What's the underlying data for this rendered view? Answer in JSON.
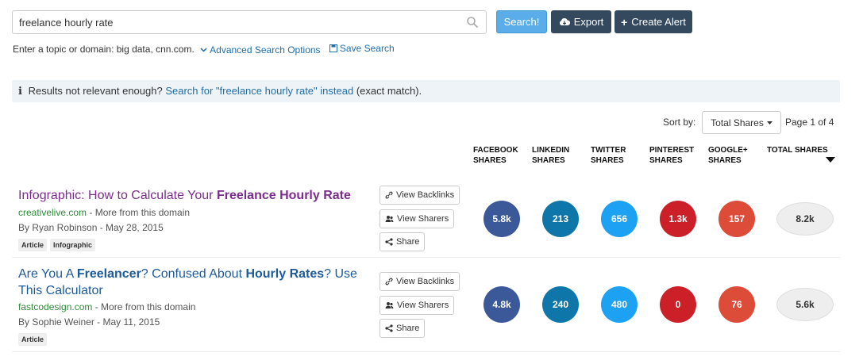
{
  "search": {
    "value": "freelance hourly rate"
  },
  "toolbar": {
    "search_label": "Search!",
    "export_label": "Export",
    "alert_label": "Create Alert"
  },
  "hint": {
    "text": "Enter a topic or domain: big data, cnn.com.",
    "advanced": "Advanced Search Options",
    "save": "Save Search"
  },
  "info": {
    "prefix": "Results not relevant enough?",
    "link": "Search for \"freelance hourly rate\" instead",
    "suffix": "(exact match)."
  },
  "sort": {
    "label": "Sort by:",
    "value": "Total Shares",
    "page": "Page 1 of 4"
  },
  "columns": [
    "FACEBOOK SHARES",
    "LINKEDIN SHARES",
    "TWITTER SHARES",
    "PINTEREST SHARES",
    "GOOGLE+ SHARES",
    "TOTAL SHARES"
  ],
  "colors": {
    "facebook": "#3b5998",
    "linkedin": "#0e76a8",
    "twitter": "#1da1f2",
    "pinterest": "#cb2027",
    "google": "#dd4b39"
  },
  "actions": {
    "backlinks": "View Backlinks",
    "sharers": "View Sharers",
    "share": "Share"
  },
  "results": [
    {
      "title_parts": [
        "Infographic: How to Calculate Your ",
        "Freelance Hourly Rate"
      ],
      "domain": "creativelive.com",
      "more": " - More from this domain",
      "byline": "By Ryan Robinson - May 28, 2015",
      "tags": [
        "Article",
        "Infographic"
      ],
      "facebook": "5.8k",
      "linkedin": "213",
      "twitter": "656",
      "pinterest": "1.3k",
      "google": "157",
      "total": "8.2k"
    },
    {
      "title_parts": [
        "Are You A ",
        "Freelancer",
        "? Confused About ",
        "Hourly Rates",
        "? Use This Calculator"
      ],
      "domain": "fastcodesign.com",
      "more": " - More from this domain",
      "byline": "By Sophie Weiner - May 11, 2015",
      "tags": [
        "Article"
      ],
      "facebook": "4.8k",
      "linkedin": "240",
      "twitter": "480",
      "pinterest": "0",
      "google": "76",
      "total": "5.6k"
    }
  ]
}
